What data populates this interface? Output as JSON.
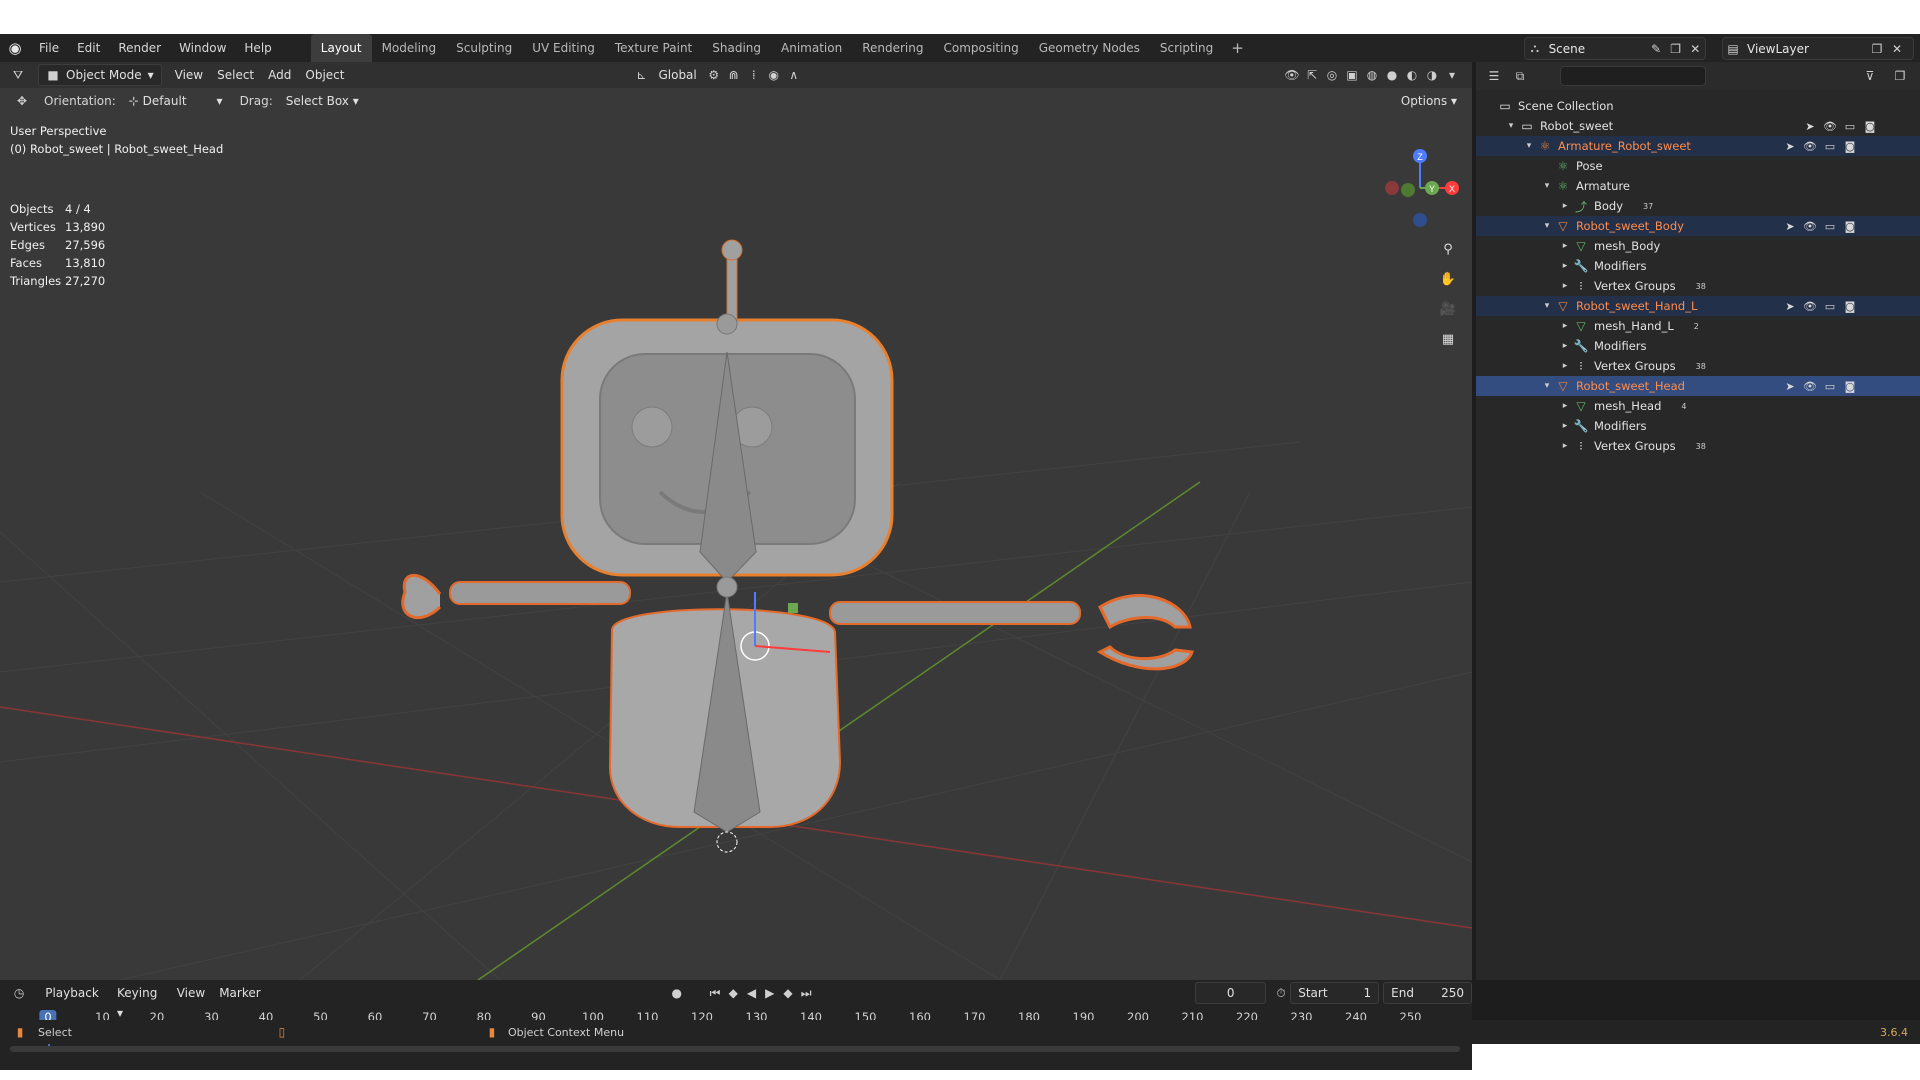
{
  "topbar": {
    "menus": [
      "File",
      "Edit",
      "Render",
      "Window",
      "Help"
    ],
    "workspaces": [
      "Layout",
      "Modeling",
      "Sculpting",
      "UV Editing",
      "Texture Paint",
      "Shading",
      "Animation",
      "Rendering",
      "Compositing",
      "Geometry Nodes",
      "Scripting"
    ],
    "active_workspace": "Layout",
    "add_tab": "+",
    "scene": "Scene",
    "view_layer": "ViewLayer"
  },
  "viewport": {
    "header": {
      "mode": "Object Mode",
      "menus": [
        "View",
        "Select",
        "Add",
        "Object"
      ],
      "transform_orientation": "Global"
    },
    "tool_header": {
      "orientation_label": "Orientation:",
      "orientation_value": "Default",
      "drag_label": "Drag:",
      "drag_value": "Select Box",
      "options": "Options"
    },
    "perspective": "User Perspective",
    "active_object": "(0) Robot_sweet | Robot_sweet_Head",
    "stats": [
      {
        "label": "Objects",
        "value": "4 / 4"
      },
      {
        "label": "Vertices",
        "value": "13,890"
      },
      {
        "label": "Edges",
        "value": "27,596"
      },
      {
        "label": "Faces",
        "value": "13,810"
      },
      {
        "label": "Triangles",
        "value": "27,270"
      }
    ],
    "gizmo": {
      "z": "Z",
      "x": "X",
      "y": "Y"
    }
  },
  "outliner": {
    "search_placeholder": "",
    "root": "Scene Collection",
    "rows": [
      {
        "label": "Robot_sweet",
        "type": "collection",
        "orange": false,
        "badge": ""
      },
      {
        "label": "Armature_Robot_sweet",
        "type": "armature",
        "orange": true,
        "badge": ""
      },
      {
        "label": "Pose",
        "type": "pose",
        "orange": false,
        "badge": ""
      },
      {
        "label": "Armature",
        "type": "armature-data",
        "orange": false,
        "badge": ""
      },
      {
        "label": "Body",
        "type": "bone",
        "orange": false,
        "badge": "37"
      },
      {
        "label": "Robot_sweet_Body",
        "type": "mesh-object",
        "orange": true,
        "badge": ""
      },
      {
        "label": "mesh_Body",
        "type": "mesh",
        "orange": false,
        "badge": ""
      },
      {
        "label": "Modifiers",
        "type": "modifiers",
        "orange": false,
        "badge": ""
      },
      {
        "label": "Vertex Groups",
        "type": "vertex-groups",
        "orange": false,
        "badge": "38"
      },
      {
        "label": "Robot_sweet_Hand_L",
        "type": "mesh-object",
        "orange": true,
        "badge": ""
      },
      {
        "label": "mesh_Hand_L",
        "type": "mesh",
        "orange": false,
        "badge": "2"
      },
      {
        "label": "Modifiers",
        "type": "modifiers",
        "orange": false,
        "badge": ""
      },
      {
        "label": "Vertex Groups",
        "type": "vertex-groups",
        "orange": false,
        "badge": "38"
      },
      {
        "label": "Robot_sweet_Head",
        "type": "mesh-object",
        "orange": true,
        "badge": ""
      },
      {
        "label": "mesh_Head",
        "type": "mesh",
        "orange": false,
        "badge": "4"
      },
      {
        "label": "Modifiers",
        "type": "modifiers",
        "orange": false,
        "badge": ""
      },
      {
        "label": "Vertex Groups",
        "type": "vertex-groups",
        "orange": false,
        "badge": "38"
      }
    ]
  },
  "timeline": {
    "menus": [
      "Playback",
      "Keying",
      "View",
      "Marker"
    ],
    "current_frame": "0",
    "start_label": "Start",
    "start_value": "1",
    "end_label": "End",
    "end_value": "250",
    "ticks": [
      "0",
      "10",
      "20",
      "30",
      "40",
      "50",
      "60",
      "70",
      "80",
      "90",
      "100",
      "110",
      "120",
      "130",
      "140",
      "150",
      "160",
      "170",
      "180",
      "190",
      "200",
      "210",
      "220",
      "230",
      "240",
      "250"
    ]
  },
  "statusbar": {
    "left": "Select",
    "middle": "Object Context Menu",
    "version": "3.6.4"
  },
  "colors": {
    "accent_selected": "#334d80",
    "object_orange": "#ff8c4a",
    "frame_blue": "#4772b3"
  }
}
